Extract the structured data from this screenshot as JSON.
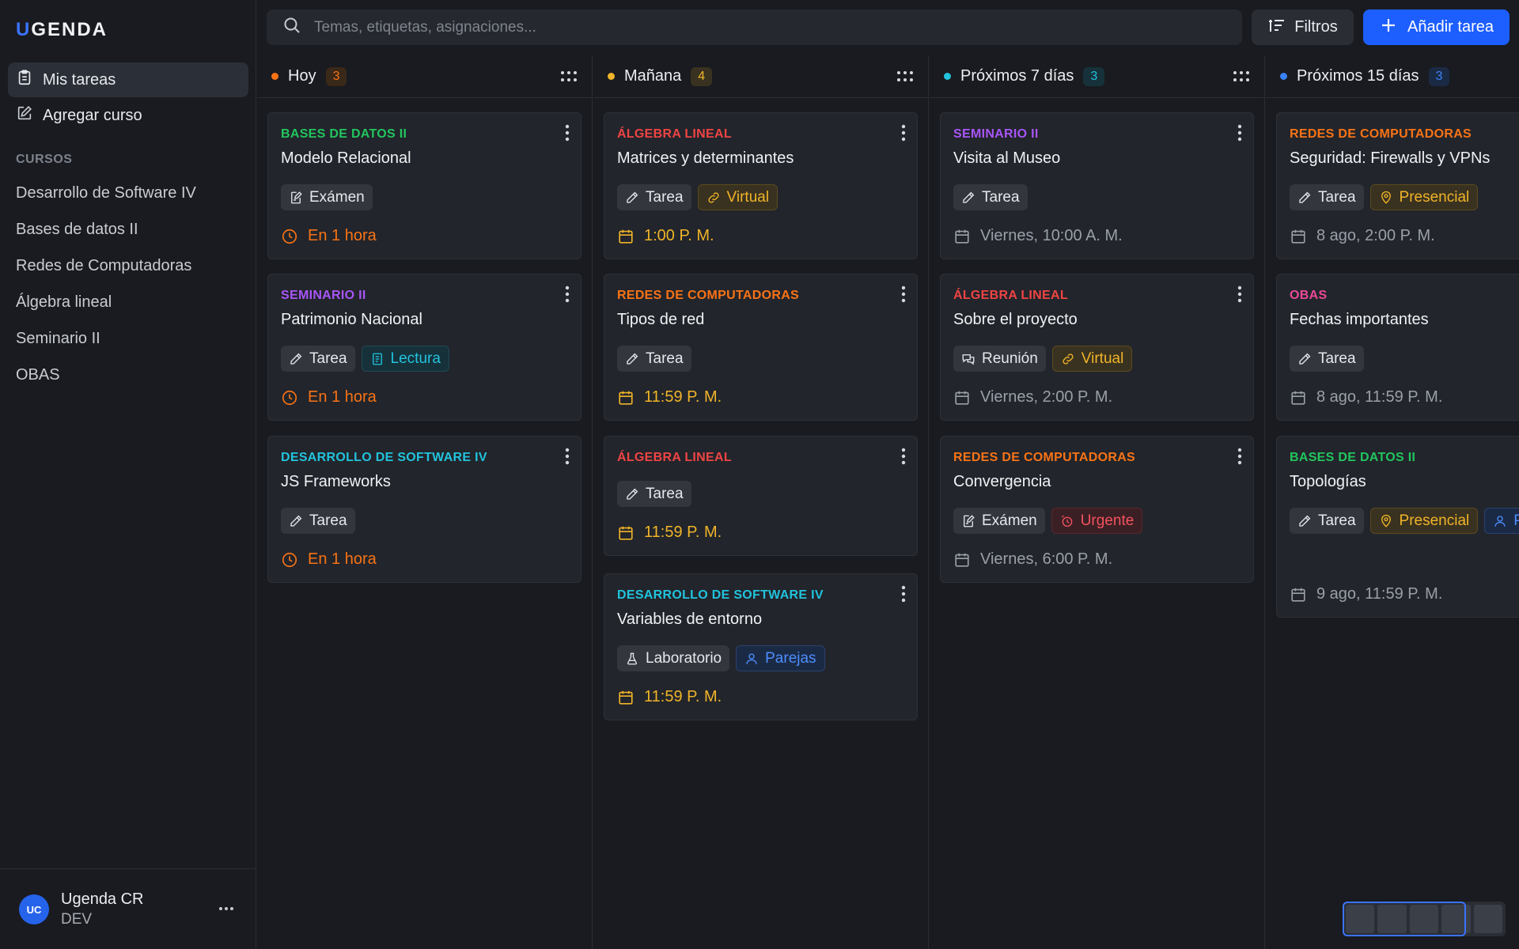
{
  "app": {
    "logo_first": "U",
    "logo_rest": "GENDA"
  },
  "sidebar": {
    "nav": [
      {
        "label": "Mis tareas",
        "icon": "clipboard-icon"
      },
      {
        "label": "Agregar curso",
        "icon": "edit-icon"
      }
    ],
    "section_label": "CURSOS",
    "courses": [
      "Desarrollo de Software IV",
      "Bases de datos II",
      "Redes de Computadoras",
      "Álgebra lineal",
      "Seminario II",
      "OBAS"
    ],
    "user": {
      "initials": "UC",
      "name": "Ugenda CR",
      "role": "DEV"
    }
  },
  "header": {
    "search_placeholder": "Temas, etiquetas, asignaciones...",
    "filters_label": "Filtros",
    "add_label": "Añadir tarea"
  },
  "colors": {
    "accent": "#1d5eff",
    "orange": "#f97316",
    "yellow": "#f0b429",
    "cyan": "#22c3dd",
    "blue": "#3b82f6",
    "green": "#22c55e",
    "purple": "#a855f7",
    "red": "#ef4444",
    "pink": "#ec4899",
    "gray": "#9aa0a9"
  },
  "columns": [
    {
      "title": "Hoy",
      "count": "3",
      "color": "#f97316",
      "cards": [
        {
          "course": "BASES DE DATOS II",
          "course_color": "#22c55e",
          "title": "Modelo Relacional",
          "tags": [
            {
              "label": "Exámen",
              "style": "neutral",
              "icon": "exam-icon"
            }
          ],
          "due": "En 1 hora",
          "due_color": "#f97316",
          "due_icon": "clock-icon"
        },
        {
          "course": "SEMINARIO II",
          "course_color": "#a855f7",
          "title": "Patrimonio Nacional",
          "tags": [
            {
              "label": "Tarea",
              "style": "neutral",
              "icon": "pencil-icon"
            },
            {
              "label": "Lectura",
              "style": "cyan",
              "icon": "book-icon"
            }
          ],
          "due": "En 1 hora",
          "due_color": "#f97316",
          "due_icon": "clock-icon"
        },
        {
          "course": "DESARROLLO DE SOFTWARE IV",
          "course_color": "#22c3dd",
          "title": "JS Frameworks",
          "tags": [
            {
              "label": "Tarea",
              "style": "neutral",
              "icon": "pencil-icon"
            }
          ],
          "due": "En 1 hora",
          "due_color": "#f97316",
          "due_icon": "clock-icon"
        }
      ]
    },
    {
      "title": "Mañana",
      "count": "4",
      "color": "#f0b429",
      "cards": [
        {
          "course": "ÁLGEBRA LINEAL",
          "course_color": "#ef4444",
          "title": "Matrices y determinantes",
          "tags": [
            {
              "label": "Tarea",
              "style": "neutral",
              "icon": "pencil-icon"
            },
            {
              "label": "Virtual",
              "style": "yellow",
              "icon": "link-icon"
            }
          ],
          "due": "1:00 P. M.",
          "due_color": "#f0b429",
          "due_icon": "calendar-icon"
        },
        {
          "course": "REDES DE COMPUTADORAS",
          "course_color": "#f97316",
          "title": "Tipos de red",
          "tags": [
            {
              "label": "Tarea",
              "style": "neutral",
              "icon": "pencil-icon"
            }
          ],
          "due": "11:59 P. M.",
          "due_color": "#f0b429",
          "due_icon": "calendar-icon"
        },
        {
          "course": "ÁLGEBRA LINEAL",
          "course_color": "#ef4444",
          "title": "",
          "tags": [
            {
              "label": "Tarea",
              "style": "neutral",
              "icon": "pencil-icon"
            }
          ],
          "due": "11:59 P. M.",
          "due_color": "#f0b429",
          "due_icon": "calendar-icon"
        },
        {
          "course": "DESARROLLO DE SOFTWARE IV",
          "course_color": "#22c3dd",
          "title": "Variables de entorno",
          "tags": [
            {
              "label": "Laboratorio",
              "style": "neutral",
              "icon": "flask-icon"
            },
            {
              "label": "Parejas",
              "style": "blue",
              "icon": "user-icon"
            }
          ],
          "due": "11:59 P. M.",
          "due_color": "#f0b429",
          "due_icon": "calendar-icon"
        }
      ]
    },
    {
      "title": "Próximos 7 días",
      "count": "3",
      "color": "#22c3dd",
      "cards": [
        {
          "course": "SEMINARIO II",
          "course_color": "#a855f7",
          "title": "Visita al Museo",
          "tags": [
            {
              "label": "Tarea",
              "style": "neutral",
              "icon": "pencil-icon"
            }
          ],
          "due": "Viernes, 10:00 A. M.",
          "due_color": "#9aa0a9",
          "due_icon": "calendar-icon"
        },
        {
          "course": "ÁLGEBRA LINEAL",
          "course_color": "#ef4444",
          "title": "Sobre el proyecto",
          "tags": [
            {
              "label": "Reunión",
              "style": "neutral",
              "icon": "chat-icon"
            },
            {
              "label": "Virtual",
              "style": "yellow",
              "icon": "link-icon"
            }
          ],
          "due": "Viernes, 2:00 P. M.",
          "due_color": "#9aa0a9",
          "due_icon": "calendar-icon"
        },
        {
          "course": "REDES DE COMPUTADORAS",
          "course_color": "#f97316",
          "title": "Convergencia",
          "tags": [
            {
              "label": "Exámen",
              "style": "neutral",
              "icon": "exam-icon"
            },
            {
              "label": "Urgente",
              "style": "red",
              "icon": "alarm-icon"
            }
          ],
          "due": "Viernes, 6:00 P. M.",
          "due_color": "#9aa0a9",
          "due_icon": "calendar-icon"
        }
      ]
    },
    {
      "title": "Próximos 15 días",
      "count": "3",
      "color": "#3b82f6",
      "cards": [
        {
          "course": "REDES DE COMPUTADORAS",
          "course_color": "#f97316",
          "title": "Seguridad: Firewalls y VPNs",
          "tags": [
            {
              "label": "Tarea",
              "style": "neutral",
              "icon": "pencil-icon"
            },
            {
              "label": "Presencial",
              "style": "yellow",
              "icon": "pin-icon"
            }
          ],
          "due": "8 ago, 2:00 P. M.",
          "due_color": "#9aa0a9",
          "due_icon": "calendar-icon"
        },
        {
          "course": "OBAS",
          "course_color": "#ec4899",
          "title": "Fechas importantes",
          "tags": [
            {
              "label": "Tarea",
              "style": "neutral",
              "icon": "pencil-icon"
            }
          ],
          "due": "8 ago, 11:59 P. M.",
          "due_color": "#9aa0a9",
          "due_icon": "calendar-icon"
        },
        {
          "course": "BASES DE DATOS II",
          "course_color": "#22c55e",
          "title": "Topologías",
          "tags": [
            {
              "label": "Tarea",
              "style": "neutral",
              "icon": "pencil-icon"
            },
            {
              "label": "Presencial",
              "style": "yellow",
              "icon": "pin-icon"
            },
            {
              "label": "Parejas",
              "style": "blue",
              "icon": "user-icon"
            }
          ],
          "due": "9 ago, 11:59 P. M.",
          "due_color": "#9aa0a9",
          "due_icon": "calendar-icon"
        }
      ]
    }
  ]
}
